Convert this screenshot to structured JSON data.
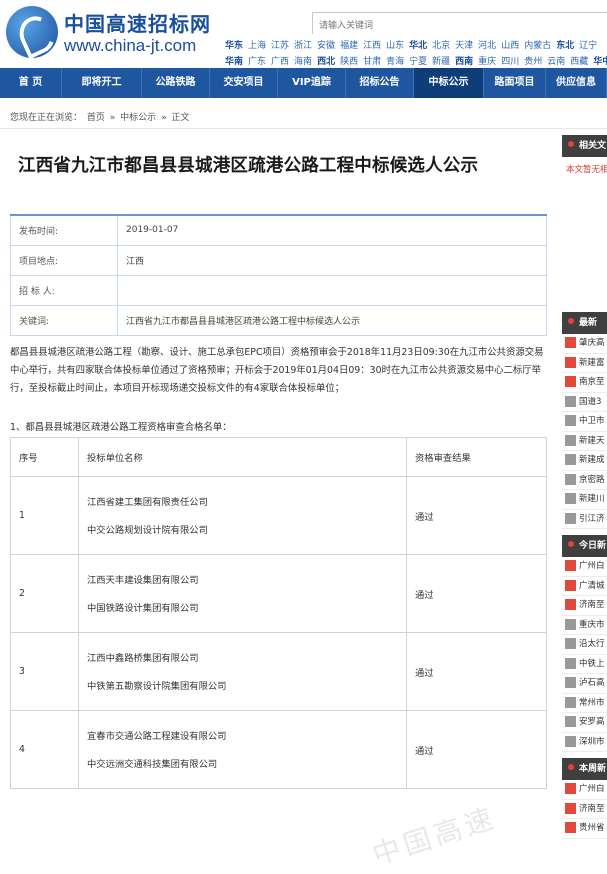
{
  "header": {
    "logo_cn": "中国高速招标网",
    "logo_en": "www.china-jt.com",
    "search_placeholder": "请输入关键词",
    "region_rows": [
      [
        {
          "t": "华东",
          "k": true
        },
        {
          "t": "上海"
        },
        {
          "t": "江苏"
        },
        {
          "t": "浙江"
        },
        {
          "t": "安徽"
        },
        {
          "t": "福建"
        },
        {
          "t": "江西"
        },
        {
          "t": "山东"
        },
        {
          "t": "华北",
          "k": true
        },
        {
          "t": "北京"
        },
        {
          "t": "天津"
        },
        {
          "t": "河北"
        },
        {
          "t": "山西"
        },
        {
          "t": "内蒙古"
        },
        {
          "t": "东北",
          "k": true
        },
        {
          "t": "辽宁"
        }
      ],
      [
        {
          "t": "华南",
          "k": true
        },
        {
          "t": "广东"
        },
        {
          "t": "广西"
        },
        {
          "t": "海南"
        },
        {
          "t": "西北",
          "k": true
        },
        {
          "t": "陕西"
        },
        {
          "t": "甘肃"
        },
        {
          "t": "青海"
        },
        {
          "t": "宁夏"
        },
        {
          "t": "新疆"
        },
        {
          "t": "西南",
          "k": true
        },
        {
          "t": "重庆"
        },
        {
          "t": "四川"
        },
        {
          "t": "贵州"
        },
        {
          "t": "云南"
        },
        {
          "t": "西藏"
        },
        {
          "t": "华中",
          "k": true
        }
      ]
    ]
  },
  "nav": [
    {
      "label": "首 页"
    },
    {
      "label": "即将开工"
    },
    {
      "label": "公路铁路"
    },
    {
      "label": "交安项目"
    },
    {
      "label": "VIP追踪"
    },
    {
      "label": "招标公告"
    },
    {
      "label": "中标公示",
      "active": true
    },
    {
      "label": "路面项目"
    },
    {
      "label": "供应信息"
    }
  ],
  "breadcrumb": {
    "prefix": "您现在正在浏览：",
    "items": [
      "首页",
      "中标公示",
      "正文"
    ],
    "sep": "»"
  },
  "article": {
    "title": "江西省九江市都昌县县城港区疏港公路工程中标候选人公示",
    "meta": [
      {
        "label": "发布时间:",
        "value": "2019-01-07"
      },
      {
        "label": "项目地点:",
        "value": "江西"
      },
      {
        "label": "招 标 人:",
        "value": ""
      },
      {
        "label": "关键词:",
        "value": "江西省九江市都昌县县城港区疏港公路工程中标候选人公示"
      }
    ],
    "intro": "都昌县县城港区疏港公路工程（勘察、设计、施工总承包EPC项目）资格预审会于2018年11月23日09:30在九江市公共资源交易中心举行，共有四家联合体投标单位通过了资格预审；开标会于2019年01月04日09：30时在九江市公共资源交易中心二标厅举行，至投标截止时间止，本项目开标现场递交投标文件的有4家联合体投标单位；",
    "section_title": "1、都昌县县城港区疏港公路工程资格审查合格名单：",
    "table_headers": [
      "序号",
      "投标单位名称",
      "资格审查结果"
    ],
    "table_rows": [
      {
        "no": "1",
        "names": [
          "江西省建工集团有限责任公司",
          "中交公路规划设计院有限公司"
        ],
        "result": "通过"
      },
      {
        "no": "2",
        "names": [
          "江西天丰建设集团有限公司",
          "中国铁路设计集团有限公司"
        ],
        "result": "通过"
      },
      {
        "no": "3",
        "names": [
          "江西中鑫路桥集团有限公司",
          "中铁第五勘察设计院集团有限公司"
        ],
        "result": "通过"
      },
      {
        "no": "4",
        "names": [
          "宜春市交通公路工程建设有限公司",
          "中交远洲交通科技集团有限公司"
        ],
        "result": "通过"
      }
    ]
  },
  "sidebar": {
    "related_title": "相关文",
    "related_note": "本文暂无相",
    "latest_title": "最新",
    "latest_items": [
      "肇庆高",
      "新建富",
      "南京至",
      "国道3",
      "中卫市",
      "新建天",
      "新建成",
      "京密路",
      "新建川",
      "引江济"
    ],
    "today_title": "今日新",
    "today_items": [
      "广州白",
      "广清城",
      "济南至",
      "重庆市",
      "沿太行",
      "中铁上",
      "泸石高",
      "常州市",
      "安罗高",
      "深圳市"
    ],
    "week_title": "本周新",
    "week_items": [
      "广州白",
      "济南至",
      "贵州省"
    ]
  },
  "watermark": "中国高速"
}
